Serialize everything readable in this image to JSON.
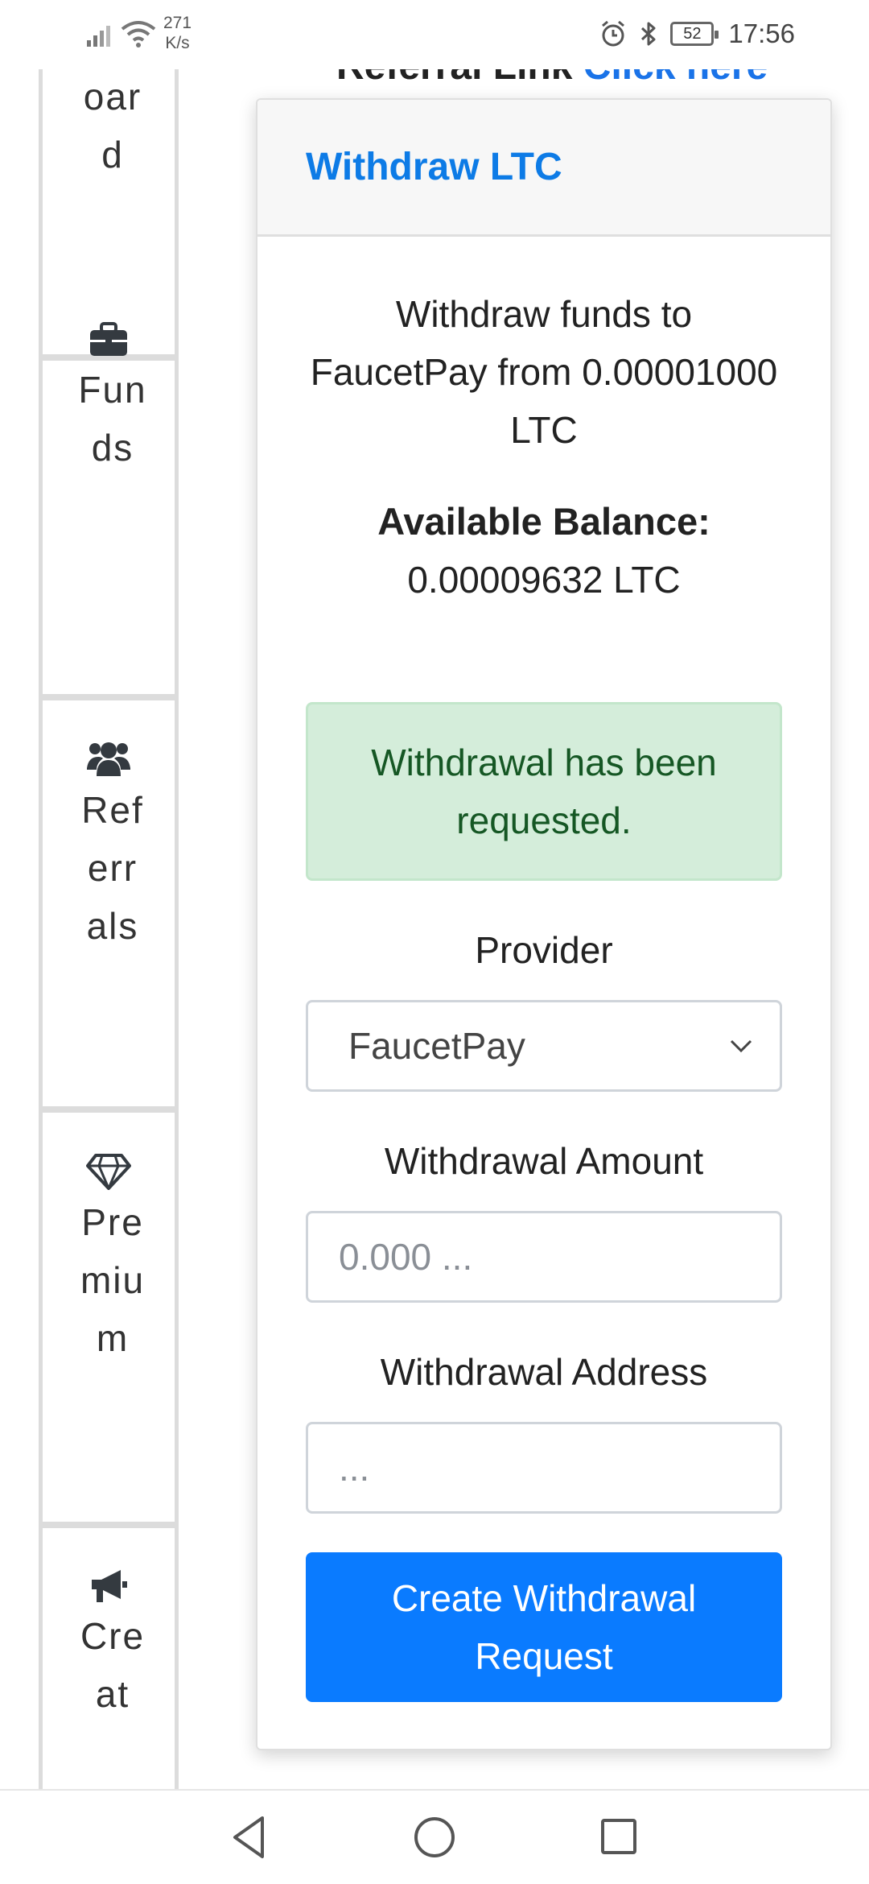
{
  "status_bar": {
    "net_speed_value": "271",
    "net_speed_unit": "K/s",
    "battery": "52",
    "time": "17:56"
  },
  "sidebar": {
    "items": [
      {
        "label": "oard",
        "icon": "dashboard-icon"
      },
      {
        "label": "Funds",
        "icon": "briefcase-icon"
      },
      {
        "label": "Referrals",
        "icon": "users-icon"
      },
      {
        "label": "Premium",
        "icon": "gem-icon"
      },
      {
        "label": "Creat",
        "icon": "bullhorn-icon"
      }
    ]
  },
  "referral": {
    "label": "Referral Link",
    "link_text": "Click here"
  },
  "card": {
    "title": "Withdraw LTC",
    "description": "Withdraw funds to FaucetPay from 0.00001000 LTC",
    "balance_label": "Available Balance:",
    "balance_value": "0.00009632 LTC",
    "alert": "Withdrawal has been requested.",
    "provider_label": "Provider",
    "provider_value": "FaucetPay",
    "amount_label": "Withdrawal Amount",
    "amount_placeholder": "0.000 ...",
    "address_label": "Withdrawal Address",
    "address_placeholder": "...",
    "submit_label": "Create Withdrawal Request"
  },
  "colors": {
    "primary": "#0a7bff",
    "title_blue": "#0d7be6",
    "success_bg": "#d4edda",
    "success_text": "#155724"
  }
}
